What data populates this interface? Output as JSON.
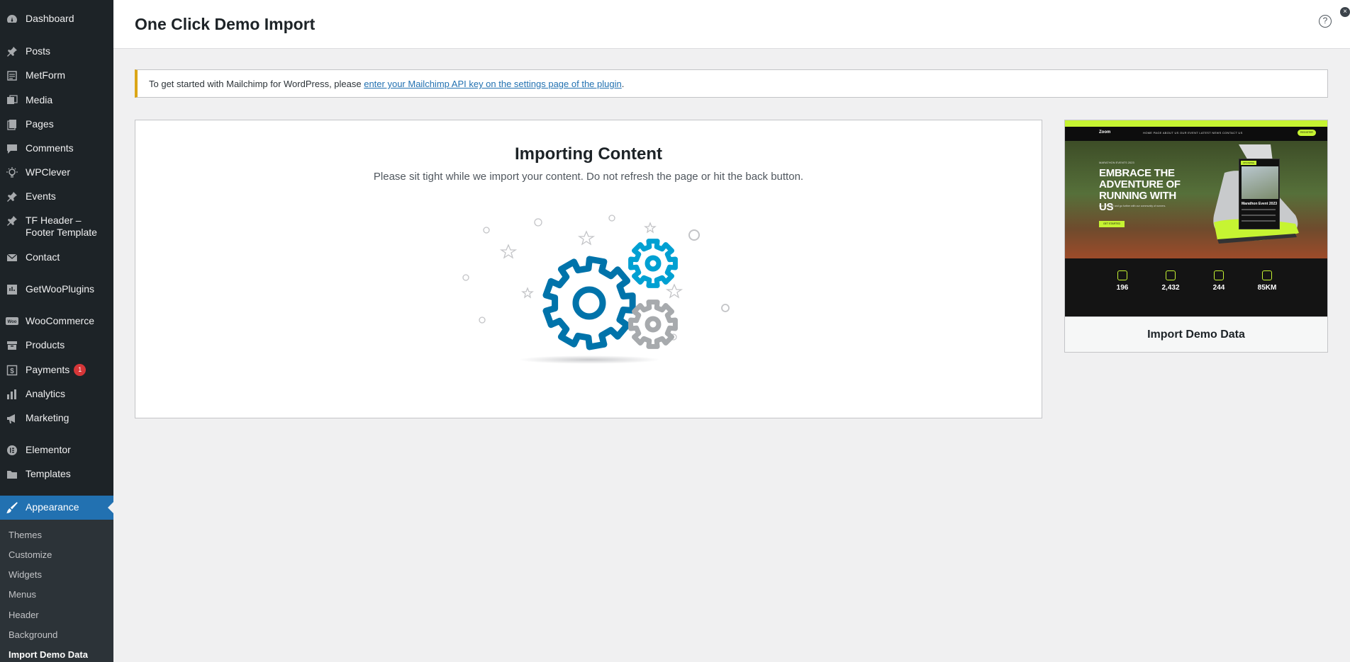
{
  "sidebar": {
    "items": [
      {
        "label": "Dashboard",
        "icon": "dashboard-icon"
      },
      {
        "label": "Posts",
        "icon": "pin-icon"
      },
      {
        "label": "MetForm",
        "icon": "form-icon"
      },
      {
        "label": "Media",
        "icon": "media-icon"
      },
      {
        "label": "Pages",
        "icon": "pages-icon"
      },
      {
        "label": "Comments",
        "icon": "comment-icon"
      },
      {
        "label": "WPClever",
        "icon": "bulb-icon"
      },
      {
        "label": "Events",
        "icon": "pin-icon"
      },
      {
        "label": "TF Header – Footer Template",
        "icon": "pin-icon"
      },
      {
        "label": "Contact",
        "icon": "mail-icon"
      },
      {
        "label": "GetWooPlugins",
        "icon": "plugin-icon"
      },
      {
        "label": "WooCommerce",
        "icon": "woo-icon"
      },
      {
        "label": "Products",
        "icon": "archive-icon"
      },
      {
        "label": "Payments",
        "icon": "dollar-icon",
        "badge": "1"
      },
      {
        "label": "Analytics",
        "icon": "chart-icon"
      },
      {
        "label": "Marketing",
        "icon": "megaphone-icon"
      },
      {
        "label": "Elementor",
        "icon": "elementor-icon"
      },
      {
        "label": "Templates",
        "icon": "folder-icon"
      }
    ],
    "active": {
      "label": "Appearance",
      "icon": "brush-icon"
    },
    "submenu": [
      "Themes",
      "Customize",
      "Widgets",
      "Menus",
      "Header",
      "Background",
      "Import Demo Data"
    ]
  },
  "header": {
    "title": "One Click Demo Import",
    "help_label": "?",
    "close_label": "×"
  },
  "notice": {
    "text": "To get started with Mailchimp for WordPress, please ",
    "link": "enter your Mailchimp API key on the settings page of the plugin",
    "suffix": "."
  },
  "import": {
    "heading": "Importing Content",
    "description": "Please sit tight while we import your content. Do not refresh the page or hit the back button."
  },
  "demo": {
    "title": "Import Demo Data",
    "preview": {
      "logo": "Zoom",
      "nav": "HOME PAGE   ABOUT US   OUR EVENT   LATEST NEWS   CONTACT US",
      "cta": "REGISTER",
      "kicker": "MARATHON EVENTS 2023",
      "headline": "EMBRACE THE ADVENTURE OF RUNNING WITH US",
      "body": "Run stronger and go further with our community of runners.",
      "button": "GET STARTED",
      "card_tag": "UPCOMING",
      "card_title": "Marathon Event 2023",
      "stats": [
        "196",
        "2,432",
        "244",
        "85KM"
      ]
    }
  },
  "colors": {
    "sidebar_bg": "#1d2327",
    "accent": "#2271b1",
    "notice_border": "#dba617",
    "gear_blue": "#0073aa",
    "gear_light_blue": "#00a0d2",
    "gear_gray": "#a7aaad",
    "preview_accent": "#c6f432"
  }
}
